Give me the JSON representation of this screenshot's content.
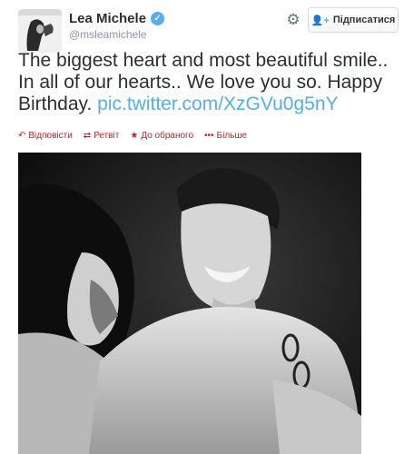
{
  "user": {
    "name": "Lea Michele",
    "handle": "@msleamichele",
    "verified": true
  },
  "follow_button": {
    "label": "Підписатися",
    "icon": "add-user-icon"
  },
  "settings_icon": "gear-icon",
  "tweet": {
    "text": "The biggest heart and most beautiful smile.. In all of our hearts.. We love you so. Happy Birthday.",
    "link": "pic.twitter.com/XzGVu0g5nY"
  },
  "actions": [
    {
      "icon": "reply-icon",
      "glyph": "↶",
      "label": "Відповісти"
    },
    {
      "icon": "retweet-icon",
      "glyph": "⇄",
      "label": "Ретвіт"
    },
    {
      "icon": "favorite-star-icon",
      "glyph": "★",
      "label": "До обраного"
    },
    {
      "icon": "more-dots-icon",
      "glyph": "•••",
      "label": "Більше"
    }
  ],
  "colors": {
    "link": "#55acee",
    "action": "#b3282d",
    "muted": "#8899a6"
  }
}
